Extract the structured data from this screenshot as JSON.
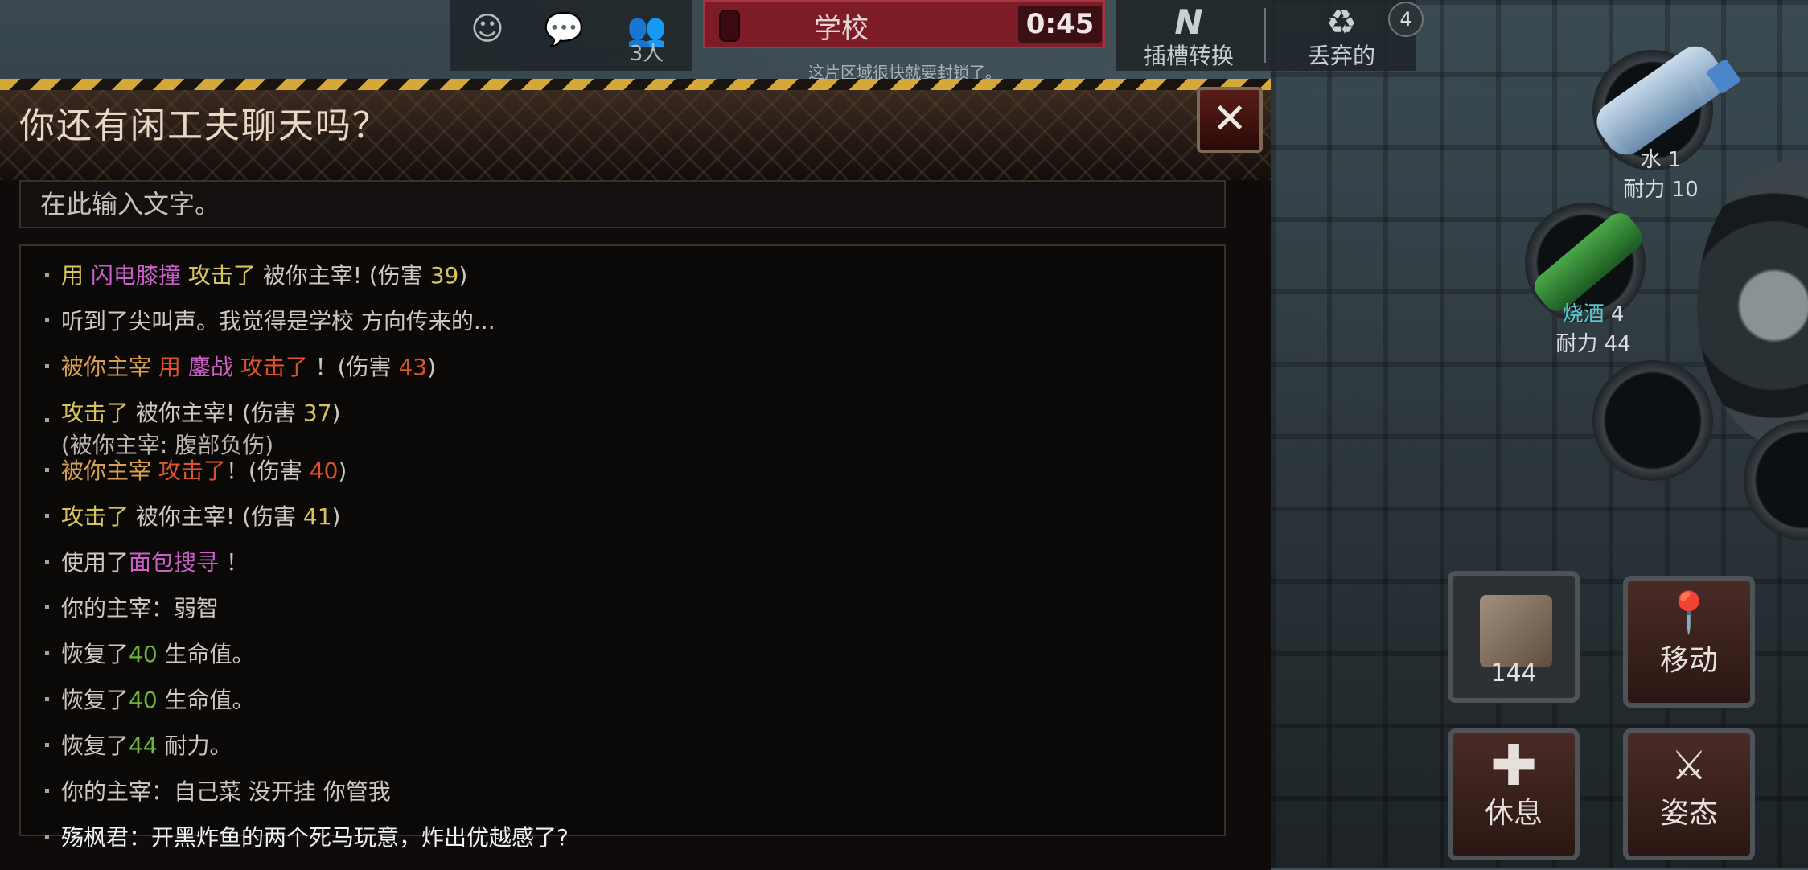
{
  "topbar": {
    "players_count": "3人",
    "location": "学校",
    "timer": "0:45",
    "zone_notice": "这片区域很快就要封锁了。",
    "slot_switch_label": "插槽转换",
    "discard_label": "丢弃的",
    "discard_count": "4"
  },
  "chat": {
    "title": "你还有闲工夫聊天吗？",
    "input_placeholder": "在此输入文字。",
    "close_icon": "close-icon"
  },
  "log": [
    {
      "parts": [
        {
          "t": "用 ",
          "c": "y"
        },
        {
          "t": "闪电膝撞",
          "c": "p"
        },
        {
          "t": " 攻击了 ",
          "c": "y"
        },
        {
          "t": " 被你主宰! (伤害 ",
          "c": ""
        },
        {
          "t": "39",
          "c": "y"
        },
        {
          "t": ")",
          "c": ""
        }
      ]
    },
    {
      "parts": [
        {
          "t": "听到了尖叫声。我觉得是学校 方向传来的...",
          "c": ""
        }
      ]
    },
    {
      "parts": [
        {
          "t": "被你主宰 ",
          "c": "o"
        },
        {
          "t": " 用 ",
          "c": "r"
        },
        {
          "t": "鏖战",
          "c": "p"
        },
        {
          "t": " 攻击了",
          "c": "r"
        },
        {
          "t": " ！(伤害 ",
          "c": ""
        },
        {
          "t": "43",
          "c": "r"
        },
        {
          "t": ")",
          "c": ""
        }
      ]
    },
    {
      "parts": [
        {
          "t": "攻击了",
          "c": "y"
        },
        {
          "t": " 被你主宰! (伤害 ",
          "c": ""
        },
        {
          "t": "37",
          "c": "y"
        },
        {
          "t": ")",
          "c": ""
        }
      ],
      "sub": "(被你主宰: 腹部负伤)"
    },
    {
      "parts": [
        {
          "t": "被你主宰 ",
          "c": "o"
        },
        {
          "t": " 攻击了",
          "c": "r"
        },
        {
          "t": "！(伤害 ",
          "c": ""
        },
        {
          "t": "40",
          "c": "r"
        },
        {
          "t": ")",
          "c": ""
        }
      ]
    },
    {
      "parts": [
        {
          "t": "攻击了",
          "c": "y"
        },
        {
          "t": " 被你主宰! (伤害 ",
          "c": ""
        },
        {
          "t": "41",
          "c": "y"
        },
        {
          "t": ")",
          "c": ""
        }
      ]
    },
    {
      "parts": [
        {
          "t": "使用了",
          "c": ""
        },
        {
          "t": "面包搜寻",
          "c": "p"
        },
        {
          "t": " ！",
          "c": ""
        }
      ]
    },
    {
      "parts": [
        {
          "t": "你的主宰：弱智",
          "c": ""
        }
      ]
    },
    {
      "parts": [
        {
          "t": "恢复了",
          "c": ""
        },
        {
          "t": "40",
          "c": "g"
        },
        {
          "t": " 生命值。",
          "c": ""
        }
      ]
    },
    {
      "parts": [
        {
          "t": "恢复了",
          "c": ""
        },
        {
          "t": "40",
          "c": "g"
        },
        {
          "t": " 生命值。",
          "c": ""
        }
      ]
    },
    {
      "parts": [
        {
          "t": "恢复了",
          "c": ""
        },
        {
          "t": "44",
          "c": "g"
        },
        {
          "t": " 耐力。",
          "c": ""
        }
      ]
    },
    {
      "parts": [
        {
          "t": "你的主宰：自己菜 没开挂 你管我",
          "c": ""
        }
      ]
    },
    {
      "parts": [
        {
          "t": "殇枫君：开黑炸鱼的两个死马玩意，炸出优越感了?",
          "c": "w"
        }
      ]
    }
  ],
  "items": {
    "water_name": "水",
    "water_count": "1",
    "water_durability": "耐力 10",
    "liquor_name": "烧酒",
    "liquor_count": "4",
    "liquor_durability": "耐力 44"
  },
  "actions": {
    "bag_count": "144",
    "move_label": "移动",
    "rest_label": "休息",
    "stance_label": "姿态"
  }
}
